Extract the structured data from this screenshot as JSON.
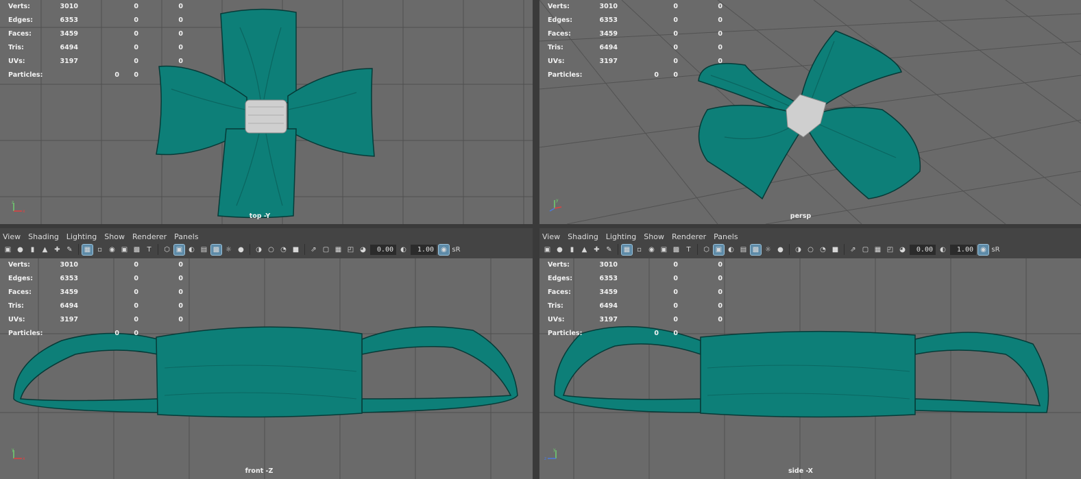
{
  "stats_labels": {
    "verts": "Verts:",
    "edges": "Edges:",
    "faces": "Faces:",
    "tris": "Tris:",
    "uvs": "UVs:",
    "particles": "Particles:"
  },
  "stats_values": {
    "verts": [
      "3010",
      "0",
      "0"
    ],
    "edges": [
      "6353",
      "0",
      "0"
    ],
    "faces": [
      "3459",
      "0",
      "0"
    ],
    "tris": [
      "6494",
      "0",
      "0"
    ],
    "uvs": [
      "3197",
      "0",
      "0"
    ],
    "particles": [
      "0",
      "0"
    ]
  },
  "viewports": {
    "top": {
      "camera": "top -Y"
    },
    "persp": {
      "camera": "persp"
    },
    "front": {
      "camera": "front -Z"
    },
    "side": {
      "camera": "side -X"
    }
  },
  "menu": {
    "view": "View",
    "shading": "Shading",
    "lighting": "Lighting",
    "show": "Show",
    "renderer": "Renderer",
    "panels": "Panels"
  },
  "toolbar": {
    "near_clip": "0.00",
    "far_clip": "1.00",
    "srgb": "sR"
  },
  "icons": [
    "camera-select-icon",
    "camera-attr-icon",
    "bookmark-icon",
    "image-plane-icon",
    "wireframe-grid-icon",
    "resolution-gate-icon",
    "field-chart-icon",
    "safe-action-icon",
    "film-gate-icon",
    "shaded-cube-icon",
    "textured-icon",
    "lights-icon",
    "shadows-icon",
    "isolate-icon",
    "xray-icon",
    "exposure-icon",
    "gamma-icon",
    "color-management-icon"
  ],
  "colors": {
    "viewport_bg": "#6a6a6a",
    "grid_line": "#505050",
    "bow_teal": "#0d7f78",
    "knot_gray": "#cfcfcf",
    "ui_panel": "#444444",
    "toggle_active": "#5e8ba8"
  }
}
